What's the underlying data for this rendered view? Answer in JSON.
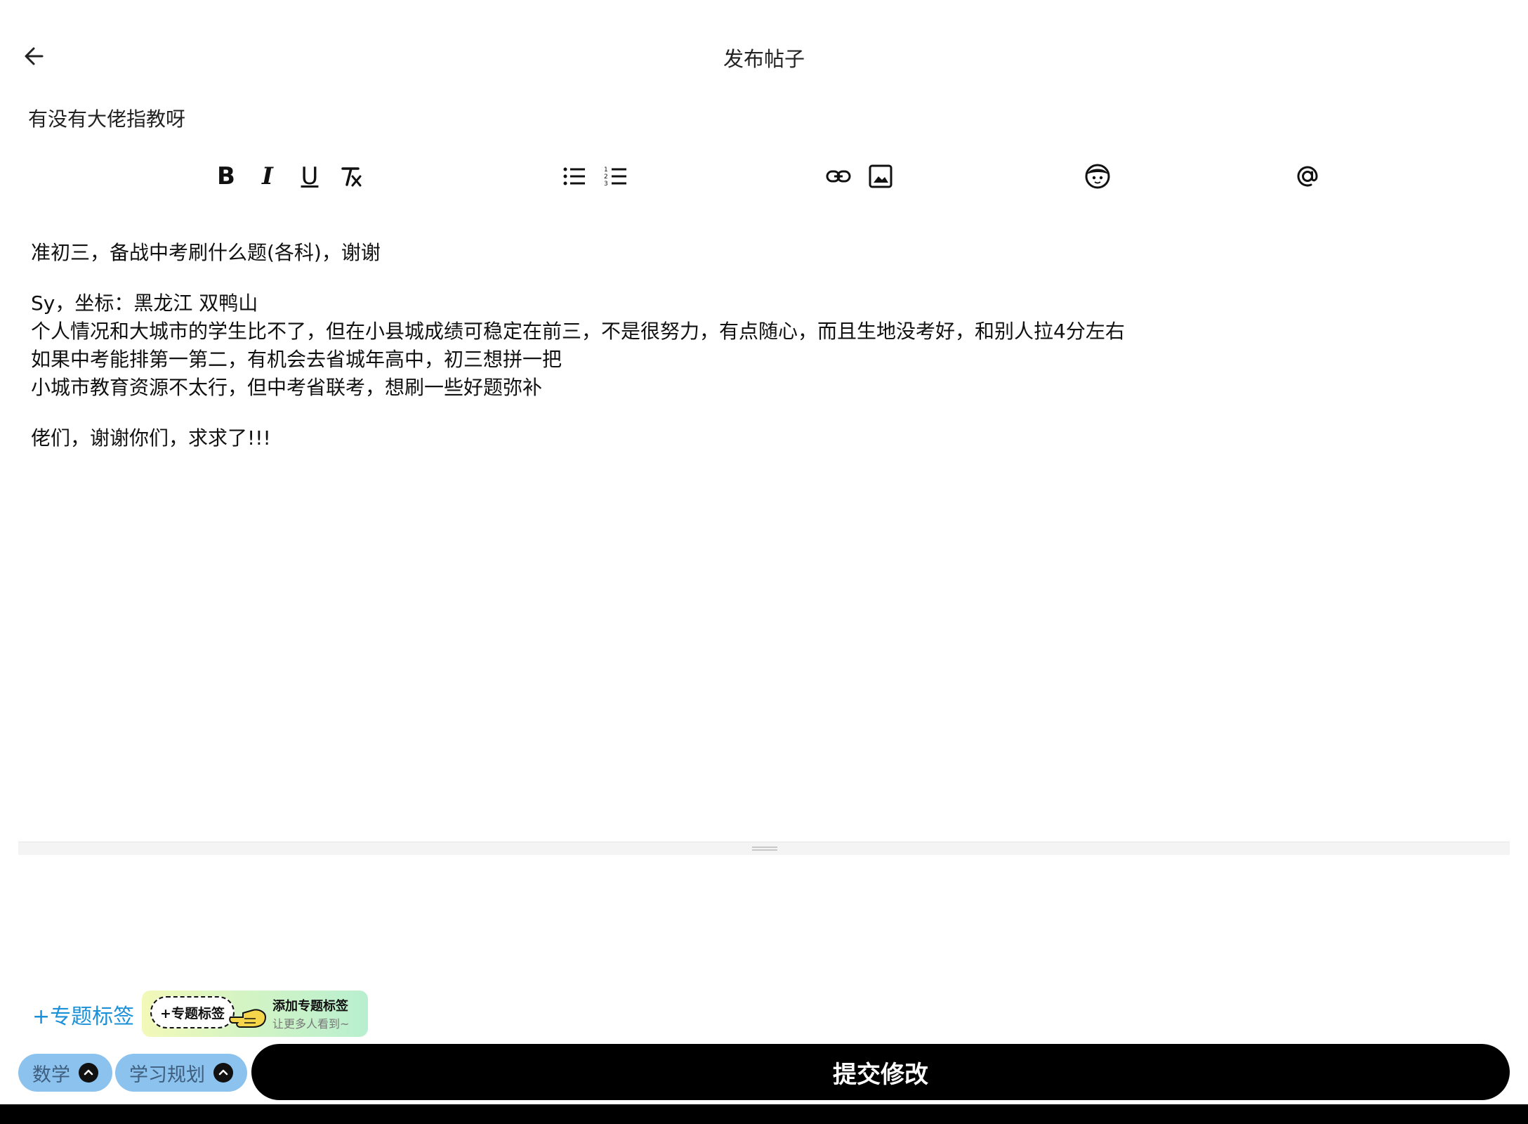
{
  "header": {
    "title": "发布帖子"
  },
  "post": {
    "title": "有没有大佬指教呀"
  },
  "toolbar": {
    "bold_label": "B",
    "italic_label": "I",
    "underline_label": "U",
    "icons": [
      "bold-icon",
      "italic-icon",
      "underline-icon",
      "clear-format-icon",
      "bullet-list-icon",
      "numbered-list-icon",
      "link-icon",
      "image-icon",
      "emoji-icon",
      "at-mention-icon"
    ]
  },
  "editor": {
    "paragraphs": [
      [
        "准初三，备战中考刷什么题(各科)，谢谢"
      ],
      [
        "Sy，坐标：黑龙江 双鸭山",
        "个人情况和大城市的学生比不了，但在小县城成绩可稳定在前三，不是很努力，有点随心，而且生地没考好，和别人拉4分左右",
        "如果中考能排第一第二，有机会去省城年高中，初三想拼一把",
        "小城市教育资源不太行，但中考省联考，想刷一些好题弥补"
      ],
      [
        "佬们，谢谢你们，求求了!!!"
      ]
    ]
  },
  "topic": {
    "add_label": "+专题标签",
    "promo_pill": "+专题标签",
    "promo_title": "添加专题标签",
    "promo_subtitle": "让更多人看到~"
  },
  "tags": [
    {
      "label": "数学"
    },
    {
      "label": "学习规划"
    }
  ],
  "submit": {
    "label": "提交修改"
  },
  "colors": {
    "accent": "#1a90d8",
    "tag_bg": "#8cc2ee",
    "button": "#000000"
  }
}
